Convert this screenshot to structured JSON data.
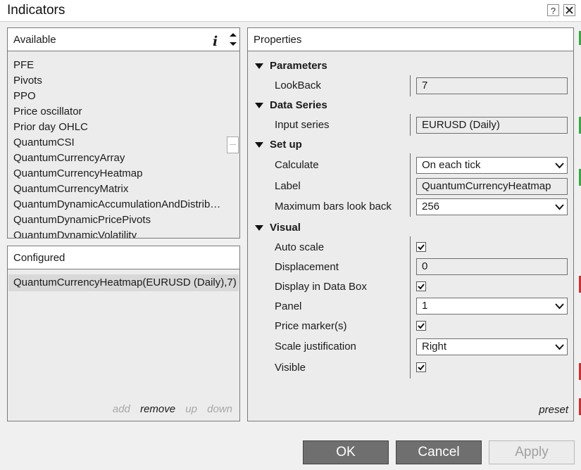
{
  "window": {
    "title": "Indicators",
    "help_label": "?"
  },
  "available": {
    "header": "Available",
    "info_label": "i",
    "items": [
      "PFE",
      "Pivots",
      "PPO",
      "Price oscillator",
      "Prior day OHLC",
      "QuantumCSI",
      "QuantumCurrencyArray",
      "QuantumCurrencyHeatmap",
      "QuantumCurrencyMatrix",
      "QuantumDynamicAccumulationAndDistrib…",
      "QuantumDynamicPricePivots",
      "QuantumDynamicVolatility"
    ]
  },
  "configured": {
    "header": "Configured",
    "items": [
      "QuantumCurrencyHeatmap(EURUSD (Daily),7)"
    ],
    "actions": {
      "add": "add",
      "remove": "remove",
      "up": "up",
      "down": "down"
    }
  },
  "properties": {
    "header": "Properties",
    "sections": {
      "parameters": "Parameters",
      "data_series": "Data Series",
      "setup": "Set up",
      "visual": "Visual"
    },
    "lookback": {
      "label": "LookBack",
      "value": "7"
    },
    "input_series": {
      "label": "Input series",
      "value": "EURUSD (Daily)"
    },
    "calculate": {
      "label": "Calculate",
      "value": "On each tick"
    },
    "label_field": {
      "label": "Label",
      "value": "QuantumCurrencyHeatmap"
    },
    "max_bars": {
      "label": "Maximum bars look back",
      "value": "256"
    },
    "auto_scale": {
      "label": "Auto scale",
      "checked": true
    },
    "displacement": {
      "label": "Displacement",
      "value": "0"
    },
    "display_in_data_box": {
      "label": "Display in Data Box",
      "checked": true
    },
    "panel": {
      "label": "Panel",
      "value": "1"
    },
    "price_markers": {
      "label": "Price marker(s)",
      "checked": true
    },
    "scale_justification": {
      "label": "Scale justification",
      "value": "Right"
    },
    "visible": {
      "label": "Visible",
      "checked": true
    },
    "preset_label": "preset"
  },
  "buttons": {
    "ok": "OK",
    "cancel": "Cancel",
    "apply": "Apply"
  },
  "colors": {
    "selected_row": "#d9d9d9",
    "button_dark": "#6f6f6f",
    "edge_green": "#3aa845",
    "edge_red": "#c83232"
  }
}
